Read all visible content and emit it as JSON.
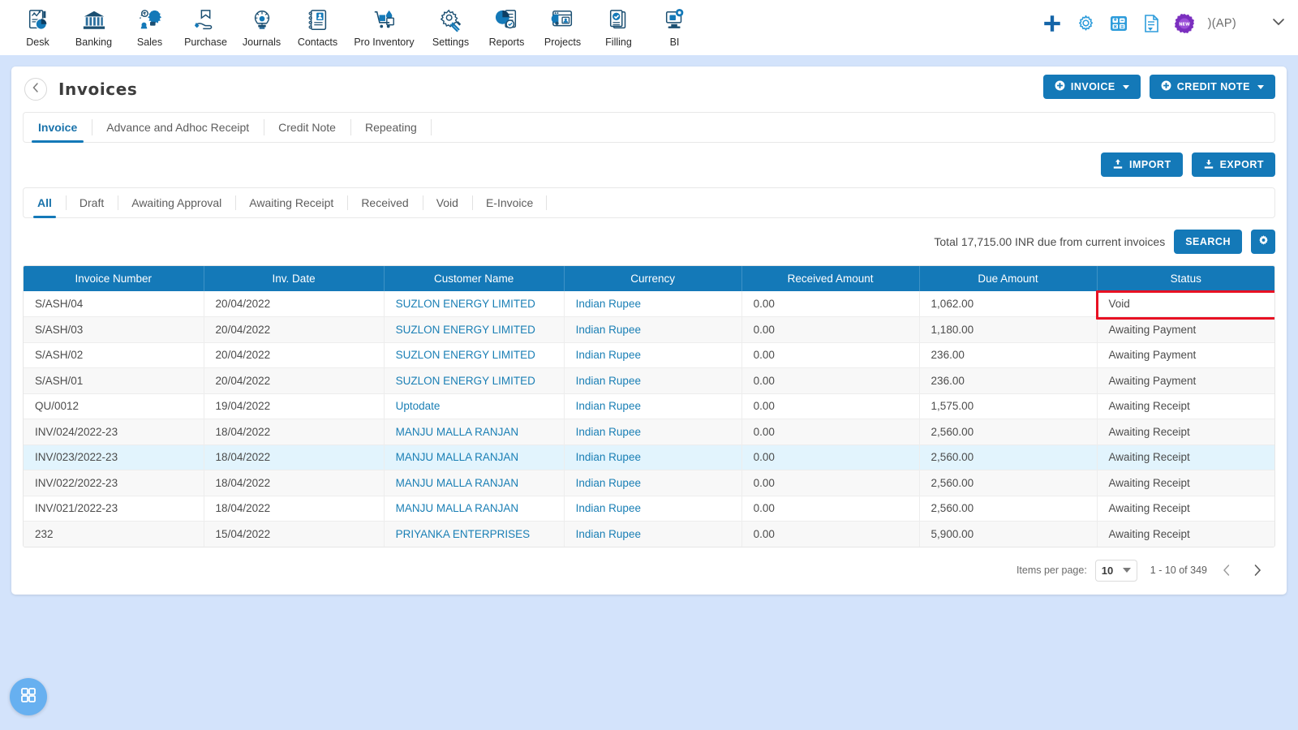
{
  "topbar": {
    "modules": [
      {
        "label": "Desk",
        "icon": "desk-icon"
      },
      {
        "label": "Banking",
        "icon": "bank-icon"
      },
      {
        "label": "Sales",
        "icon": "sales-icon"
      },
      {
        "label": "Purchase",
        "icon": "purchase-icon"
      },
      {
        "label": "Journals",
        "icon": "journals-icon"
      },
      {
        "label": "Contacts",
        "icon": "contacts-icon"
      },
      {
        "label": "Pro Inventory",
        "icon": "inventory-icon"
      },
      {
        "label": "Settings",
        "icon": "settings-icon"
      },
      {
        "label": "Reports",
        "icon": "reports-icon"
      },
      {
        "label": "Projects",
        "icon": "projects-icon"
      },
      {
        "label": "Filling",
        "icon": "filling-icon"
      },
      {
        "label": "BI",
        "icon": "bi-icon"
      }
    ],
    "right": {
      "add_icon": "plus-icon",
      "settings_icon": "gear-icon",
      "calculator_icon": "calculator-icon",
      "notes_icon": "document-icon",
      "new_badge_icon": "new-badge-icon",
      "new_badge_label": "NEW",
      "account_label": ")(AP)",
      "chevron_icon": "chevron-down-icon"
    }
  },
  "header": {
    "back_icon": "chevron-left-icon",
    "title": "Invoices",
    "invoice_button": "INVOICE",
    "credit_note_button": "CREDIT NOTE"
  },
  "tabs": [
    {
      "label": "Invoice",
      "active": true
    },
    {
      "label": "Advance and Adhoc Receipt",
      "active": false
    },
    {
      "label": "Credit Note",
      "active": false
    },
    {
      "label": "Repeating",
      "active": false
    }
  ],
  "toolbar": {
    "import_label": "IMPORT",
    "export_label": "EXPORT",
    "import_icon": "upload-icon",
    "export_icon": "download-icon"
  },
  "filters": [
    {
      "label": "All",
      "active": true
    },
    {
      "label": "Draft",
      "active": false
    },
    {
      "label": "Awaiting Approval",
      "active": false
    },
    {
      "label": "Awaiting Receipt",
      "active": false
    },
    {
      "label": "Received",
      "active": false
    },
    {
      "label": "Void",
      "active": false
    },
    {
      "label": "E-Invoice",
      "active": false
    }
  ],
  "summary": {
    "total_text": "Total 17,715.00 INR due from current invoices",
    "search_label": "SEARCH",
    "gear_icon": "gear-icon"
  },
  "table": {
    "columns": [
      "Invoice Number",
      "Inv. Date",
      "Customer Name",
      "Currency",
      "Received Amount",
      "Due Amount",
      "Status"
    ],
    "rows": [
      {
        "invoice_number": "S/ASH/04",
        "inv_date": "20/04/2022",
        "customer": "SUZLON ENERGY LIMITED",
        "currency": "Indian Rupee",
        "received": "0.00",
        "due": "1,062.00",
        "status": "Void",
        "highlighted": false
      },
      {
        "invoice_number": "S/ASH/03",
        "inv_date": "20/04/2022",
        "customer": "SUZLON ENERGY LIMITED",
        "currency": "Indian Rupee",
        "received": "0.00",
        "due": "1,180.00",
        "status": "Awaiting Payment",
        "highlighted": false
      },
      {
        "invoice_number": "S/ASH/02",
        "inv_date": "20/04/2022",
        "customer": "SUZLON ENERGY LIMITED",
        "currency": "Indian Rupee",
        "received": "0.00",
        "due": "236.00",
        "status": "Awaiting Payment",
        "highlighted": false
      },
      {
        "invoice_number": "S/ASH/01",
        "inv_date": "20/04/2022",
        "customer": "SUZLON ENERGY LIMITED",
        "currency": "Indian Rupee",
        "received": "0.00",
        "due": "236.00",
        "status": "Awaiting Payment",
        "highlighted": false
      },
      {
        "invoice_number": "QU/0012",
        "inv_date": "19/04/2022",
        "customer": "Uptodate",
        "currency": "Indian Rupee",
        "received": "0.00",
        "due": "1,575.00",
        "status": "Awaiting Receipt",
        "highlighted": false
      },
      {
        "invoice_number": "INV/024/2022-23",
        "inv_date": "18/04/2022",
        "customer": "MANJU MALLA RANJAN",
        "currency": "Indian Rupee",
        "received": "0.00",
        "due": "2,560.00",
        "status": "Awaiting Receipt",
        "highlighted": false
      },
      {
        "invoice_number": "INV/023/2022-23",
        "inv_date": "18/04/2022",
        "customer": "MANJU MALLA RANJAN",
        "currency": "Indian Rupee",
        "received": "0.00",
        "due": "2,560.00",
        "status": "Awaiting Receipt",
        "highlighted": true
      },
      {
        "invoice_number": "INV/022/2022-23",
        "inv_date": "18/04/2022",
        "customer": "MANJU MALLA RANJAN",
        "currency": "Indian Rupee",
        "received": "0.00",
        "due": "2,560.00",
        "status": "Awaiting Receipt",
        "highlighted": false
      },
      {
        "invoice_number": "INV/021/2022-23",
        "inv_date": "18/04/2022",
        "customer": "MANJU MALLA RANJAN",
        "currency": "Indian Rupee",
        "received": "0.00",
        "due": "2,560.00",
        "status": "Awaiting Receipt",
        "highlighted": false
      },
      {
        "invoice_number": "232",
        "inv_date": "15/04/2022",
        "customer": "PRIYANKA ENTERPRISES",
        "currency": "Indian Rupee",
        "received": "0.00",
        "due": "5,900.00",
        "status": "Awaiting Receipt",
        "highlighted": false
      }
    ]
  },
  "annotation": {
    "color": "#e81123",
    "target": "status-cell-void"
  },
  "paginator": {
    "items_per_page_label": "Items per page:",
    "items_per_page_value": "10",
    "range_label": "1 - 10 of 349",
    "prev_icon": "chevron-left-icon",
    "next_icon": "chevron-right-icon"
  },
  "fab": {
    "icon": "grid-apps-icon"
  },
  "colors": {
    "accent": "#1479b8",
    "page_background": "#d3e3fb",
    "annotation": "#e81123",
    "link": "#1a7fb5",
    "row_highlight": "#e2f4fd",
    "fab": "#67b0f0"
  }
}
